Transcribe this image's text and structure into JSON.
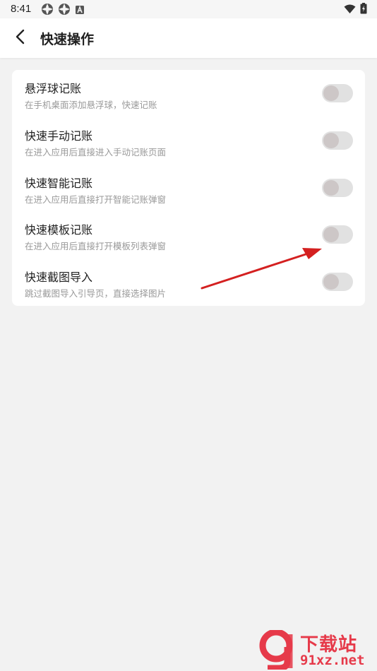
{
  "status_bar": {
    "time": "8:41",
    "left_icons": [
      "settings-app-icon",
      "settings-app-icon",
      "font-app-icon"
    ],
    "right_icons": [
      "wifi-icon",
      "battery-charging-icon"
    ]
  },
  "header": {
    "title": "快速操作",
    "back_icon": "chevron-left-icon"
  },
  "settings": [
    {
      "title": "悬浮球记账",
      "desc": "在手机桌面添加悬浮球，快速记账",
      "enabled": false
    },
    {
      "title": "快速手动记账",
      "desc": "在进入应用后直接进入手动记账页面",
      "enabled": false
    },
    {
      "title": "快速智能记账",
      "desc": "在进入应用后直接打开智能记账弹窗",
      "enabled": false
    },
    {
      "title": "快速模板记账",
      "desc": "在进入应用后直接打开模板列表弹窗",
      "enabled": false
    },
    {
      "title": "快速截图导入",
      "desc": "跳过截图导入引导页，直接选择图片",
      "enabled": false
    }
  ],
  "annotation": {
    "arrow_color": "#d42020"
  },
  "watermark": {
    "logo_text": "9",
    "line1": "下载站",
    "line2": "91xz.net",
    "color": "#e63a4a"
  },
  "colors": {
    "background": "#f2f2f2",
    "card": "#ffffff",
    "toggle_track": "#e1e1e1",
    "toggle_knob": "#cdc7c7"
  }
}
